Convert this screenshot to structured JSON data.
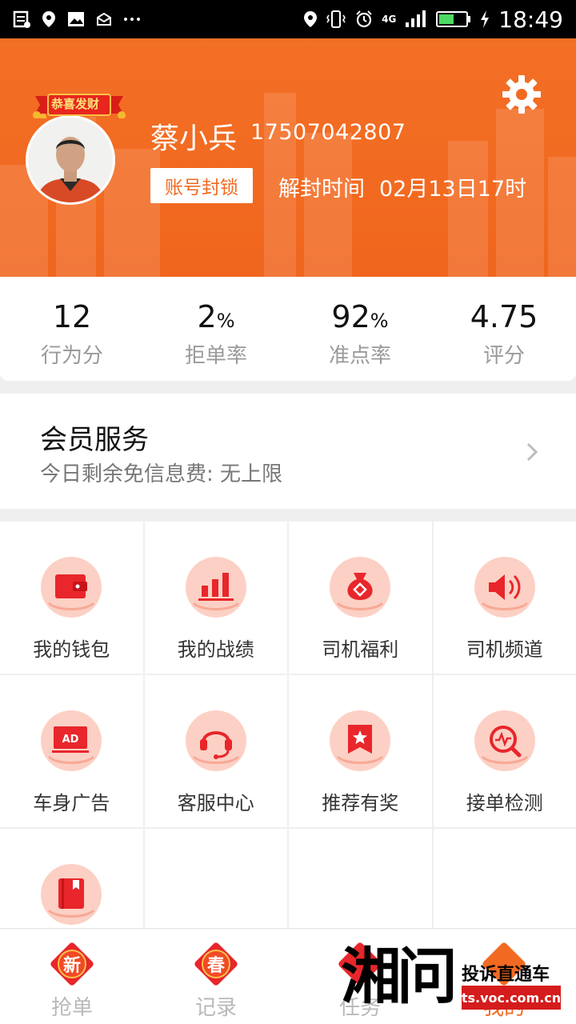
{
  "status_bar": {
    "time": "18:49",
    "network": "4G",
    "left_icons": [
      "message-icon",
      "location-icon",
      "image-icon",
      "mail-icon",
      "more-icon"
    ],
    "right_icons": [
      "location-icon",
      "vibrate-icon",
      "alarm-icon",
      "signal-icon",
      "battery-icon",
      "charging-icon"
    ]
  },
  "header": {
    "avatar_ribbon": "恭喜发财",
    "user_name": "蔡小兵",
    "phone": "17507042807",
    "lock_badge": "账号封锁",
    "unlock_label": "解封时间",
    "unlock_time": "02月13日17时",
    "settings_icon": "gear-icon",
    "background_color": "#f26a21"
  },
  "stats": [
    {
      "value": "12",
      "unit": "",
      "label": "行为分"
    },
    {
      "value": "2",
      "unit": "%",
      "label": "拒单率"
    },
    {
      "value": "92",
      "unit": "%",
      "label": "准点率"
    },
    {
      "value": "4.75",
      "unit": "",
      "label": "评分"
    }
  ],
  "member": {
    "title": "会员服务",
    "subtitle": "今日剩余免信息费: 无上限"
  },
  "grid": [
    {
      "label": "我的钱包",
      "icon": "wallet-icon"
    },
    {
      "label": "我的战绩",
      "icon": "bar-chart-icon"
    },
    {
      "label": "司机福利",
      "icon": "money-bag-icon"
    },
    {
      "label": "司机频道",
      "icon": "speaker-icon"
    },
    {
      "label": "车身广告",
      "icon": "ad-icon"
    },
    {
      "label": "客服中心",
      "icon": "headset-icon"
    },
    {
      "label": "推荐有奖",
      "icon": "star-bookmark-icon"
    },
    {
      "label": "接单检测",
      "icon": "search-pulse-icon"
    },
    {
      "label": "",
      "icon": "book-icon"
    }
  ],
  "bottom_nav": [
    {
      "label": "抢单",
      "badge": "新",
      "active": false
    },
    {
      "label": "记录",
      "badge": "春",
      "active": false
    },
    {
      "label": "任务",
      "badge": "",
      "active": false
    },
    {
      "label": "我的",
      "badge": "",
      "active": true
    }
  ],
  "watermark": {
    "logo": "湘问",
    "slogan": "投诉直通车",
    "url": "ts.voc.com.cn"
  },
  "colors": {
    "accent": "#f26a21",
    "icon_red": "#e8262b",
    "icon_bg": "#fcd0c4",
    "watermark_red": "#d51c1c"
  }
}
